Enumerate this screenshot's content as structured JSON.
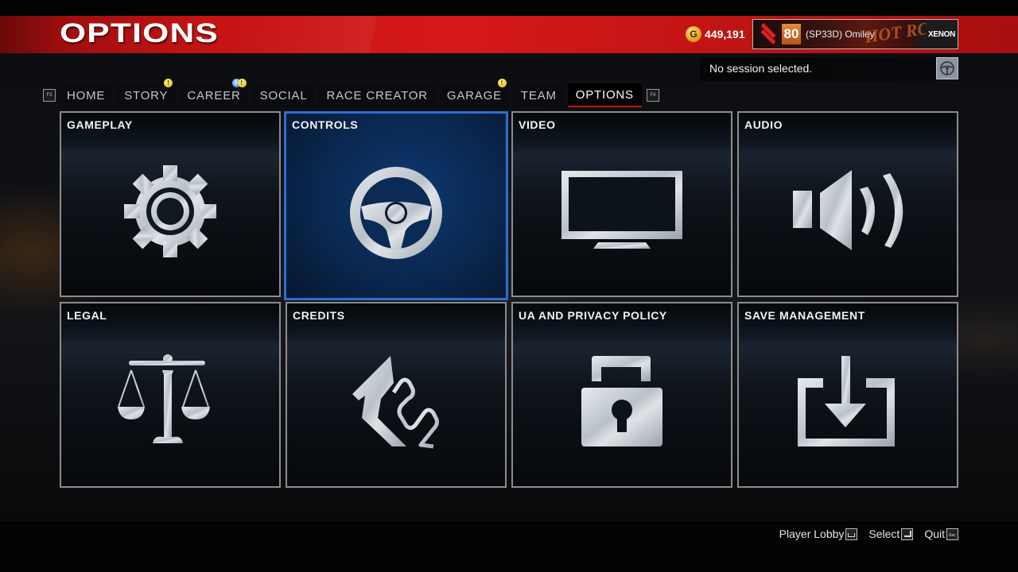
{
  "header": {
    "title": "OPTIONS",
    "currency": {
      "icon": "coin-icon",
      "symbol": "G",
      "value": "449,191",
      "color": "#e0a820"
    },
    "player": {
      "rank_icon": "rank-insignia-icon",
      "level": "80",
      "name": "(SP33D) Omiley",
      "banner_text": "HOT ROD",
      "crew": "XENON"
    },
    "accent_color": "#d01818"
  },
  "session": {
    "status": "No session selected.",
    "icon": "steering-wheel-icon"
  },
  "tabs": {
    "prev_key": "F3",
    "next_key": "F4",
    "items": [
      {
        "label": "HOME",
        "active": false
      },
      {
        "label": "STORY",
        "active": false,
        "badges": [
          "alert"
        ]
      },
      {
        "label": "CAREER",
        "active": false,
        "badges": [
          "info",
          "alert"
        ]
      },
      {
        "label": "SOCIAL",
        "active": false
      },
      {
        "label": "RACE CREATOR",
        "active": false
      },
      {
        "label": "GARAGE",
        "active": false,
        "badges": [
          "alert"
        ]
      },
      {
        "label": "TEAM",
        "active": false
      },
      {
        "label": "OPTIONS",
        "active": true
      }
    ]
  },
  "tiles": [
    {
      "label": "GAMEPLAY",
      "icon": "gear-icon",
      "selected": false
    },
    {
      "label": "CONTROLS",
      "icon": "steering-wheel-icon",
      "selected": true
    },
    {
      "label": "VIDEO",
      "icon": "monitor-icon",
      "selected": false
    },
    {
      "label": "AUDIO",
      "icon": "speaker-icon",
      "selected": false
    },
    {
      "label": "LEGAL",
      "icon": "scales-icon",
      "selected": false
    },
    {
      "label": "CREDITS",
      "icon": "studio-logo-icon",
      "selected": false
    },
    {
      "label": "UA AND PRIVACY POLICY",
      "icon": "padlock-icon",
      "selected": false
    },
    {
      "label": "SAVE MANAGEMENT",
      "icon": "download-icon",
      "selected": false
    }
  ],
  "footer": {
    "actions": [
      {
        "label": "Player Lobby",
        "key": "Space"
      },
      {
        "label": "Select",
        "key": "Enter"
      },
      {
        "label": "Quit",
        "key": "Esc"
      }
    ]
  },
  "colors": {
    "selection": "#2d6fd0",
    "tile_border": "#8c8c8c"
  }
}
